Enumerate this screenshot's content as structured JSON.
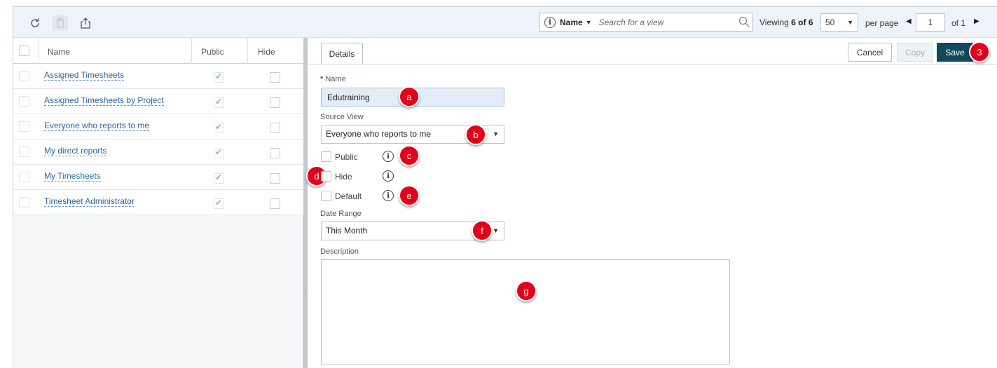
{
  "toolbar": {
    "search_field": "Name",
    "search_placeholder": "Search for a view",
    "viewing_prefix": "Viewing",
    "viewing_count": "6 of 6",
    "per_page_value": "50",
    "per_page_label": "per page",
    "page_value": "1",
    "page_of": "of 1"
  },
  "grid": {
    "headers": {
      "name": "Name",
      "public": "Public",
      "hide": "Hide"
    },
    "rows": [
      {
        "name": "Assigned Timesheets",
        "public": true,
        "hide": false
      },
      {
        "name": "Assigned Timesheets by Project",
        "public": true,
        "hide": false
      },
      {
        "name": "Everyone who reports to me",
        "public": true,
        "hide": false
      },
      {
        "name": "My direct reports",
        "public": true,
        "hide": false
      },
      {
        "name": "My Timesheets",
        "public": true,
        "hide": false
      },
      {
        "name": "Timesheet Administrator",
        "public": true,
        "hide": false
      }
    ]
  },
  "details": {
    "tab_label": "Details",
    "cancel_label": "Cancel",
    "copy_label": "Copy",
    "save_label": "Save",
    "name_required": "*",
    "name_label": "Name",
    "name_value": "Edutraining",
    "source_view_label": "Source View",
    "source_view_value": "Everyone who reports to me",
    "public_label": "Public",
    "hide_label": "Hide",
    "default_label": "Default",
    "date_range_label": "Date Range",
    "date_range_value": "This Month",
    "description_label": "Description"
  },
  "markers": {
    "save": "3",
    "a": "a",
    "b": "b",
    "c": "c",
    "d": "d",
    "e": "e",
    "f": "f",
    "g": "g"
  },
  "colors": {
    "save_button": "#10495e",
    "link": "#2b65a8",
    "marker": "#e3001b",
    "toolbar_bg": "#edf3f8"
  }
}
